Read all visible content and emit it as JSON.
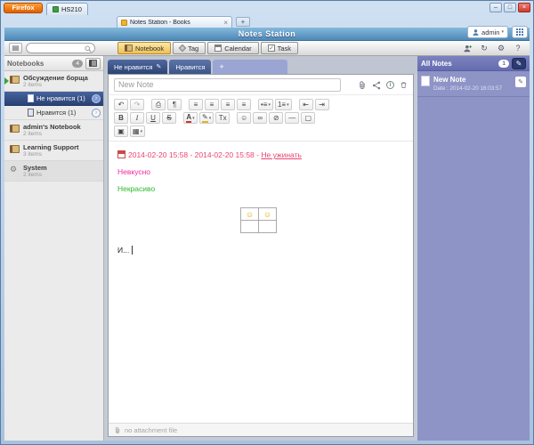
{
  "window": {
    "firefox_button": "Firefox",
    "app_tab": "HS210",
    "tab_title": "Notes Station - Books",
    "tab_close": "×",
    "new_tab": "+",
    "minimize": "–",
    "maximize": "□",
    "close": "×"
  },
  "header": {
    "title": "Notes Station",
    "user_name": "admin",
    "user_caret": "▾"
  },
  "toolbar": {
    "nav": [
      {
        "label": "Notebook"
      },
      {
        "label": "Tag"
      },
      {
        "label": "Calendar"
      },
      {
        "label": "Task"
      }
    ]
  },
  "icons": {
    "view_toggle": "▤",
    "refresh": "↻",
    "gear": "⚙",
    "help": "?",
    "chevron": "›",
    "pencil": "✎",
    "system": "⚙"
  },
  "sidebar": {
    "title": "Notebooks",
    "count": "4",
    "notebook1": {
      "label": "Обсуждение борща",
      "meta": "2 items"
    },
    "sub1": {
      "label": "Не нравится",
      "count": "(1)"
    },
    "sub2": {
      "label": "Нравится",
      "count": "(1)"
    },
    "notebook2": {
      "label": "admin's Notebook",
      "meta": "2 items"
    },
    "notebook3": {
      "label": "Learning Support",
      "meta": "3 items"
    },
    "notebook4": {
      "label": "System",
      "meta": "2 items"
    }
  },
  "note_tabs": {
    "tab1": "Не нравится",
    "tab2": "Нравится",
    "add": "+"
  },
  "editor": {
    "title": "New Note",
    "toolbar": {
      "undo": "↶",
      "redo": "↷",
      "print": "⎙",
      "paragraph": "¶",
      "align_left": "≡",
      "align_center": "≡",
      "align_right": "≡",
      "align_justify": "≡",
      "list_bullet": "•≡",
      "list_number": "1≡",
      "outdent": "⇤",
      "indent": "⇥",
      "bold": "B",
      "italic": "I",
      "underline": "U",
      "strike": "S",
      "font_color": "A",
      "highlight": "✎",
      "clear_format": "Tx",
      "smiley": "☺",
      "link": "∞",
      "unlink": "⊘",
      "hr": "—",
      "expand": "▢",
      "image": "▣",
      "table": "▦",
      "caret": "▾"
    },
    "content": {
      "event_text": "2014-02-20 15:58 - 2014-02-20 15:58 - ",
      "event_link": "Не ужинать",
      "line2": "Невкусно",
      "line3": "Некрасиво",
      "smiley1": "☺",
      "smiley2": "☺",
      "typing": "И..."
    },
    "attachment_hint": "no attachment file"
  },
  "all_notes": {
    "title": "All Notes",
    "count": "1",
    "item": {
      "title": "New Note",
      "date": "Date : 2014-02-20 16:03:57"
    }
  },
  "colors": {
    "event_text": "#e8476f",
    "dislike_text": "#f02ca0",
    "ugly_text": "#2db82d",
    "accent_navy": "#2d4474",
    "panel_purple": "#8e94c6",
    "active_nav": "#eebf55"
  }
}
